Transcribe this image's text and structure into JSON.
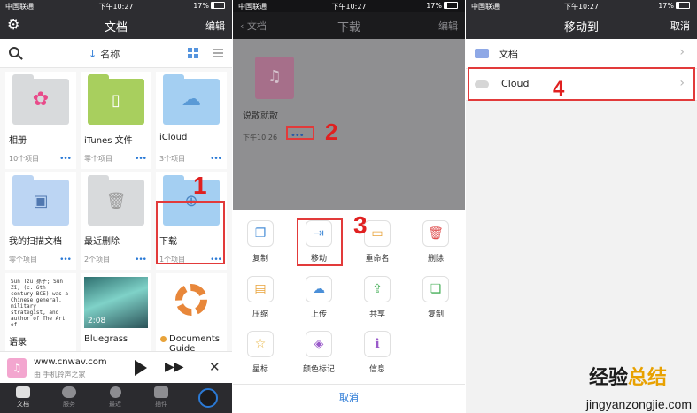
{
  "status": {
    "carrier": "中国联通",
    "time": "下午10:27",
    "battery": "17%"
  },
  "panel1": {
    "title": "文档",
    "edit": "编辑",
    "sort_label": "名称",
    "tiles": [
      {
        "name": "相册",
        "count": "10个项目"
      },
      {
        "name": "iTunes 文件",
        "count": "零个项目"
      },
      {
        "name": "iCloud",
        "count": "3个项目"
      },
      {
        "name": "我的扫描文档",
        "count": "零个项目"
      },
      {
        "name": "最近删除",
        "count": "2个项目"
      },
      {
        "name": "下载",
        "count": "1个项目"
      },
      {
        "name": "语录",
        "count": ""
      },
      {
        "name": "Bluegrass",
        "count": ""
      },
      {
        "name": "Documents Guide",
        "count": ""
      }
    ],
    "doc_preview": "Sun Tzu 孫子; Sūn Zǐ; (c. 6th century BCE) was a Chinese general, military strategist, and author of The Art of",
    "video_time": "2:08",
    "media": {
      "title": "www.cnwav.com",
      "subtitle": "由 手机铃声之家"
    },
    "tabs": [
      "文档",
      "服务",
      "最近",
      "插件"
    ]
  },
  "panel2": {
    "back": "文档",
    "title": "下载",
    "edit": "编辑",
    "file": {
      "name": "说散就散",
      "time": "下午10:26",
      "dots": "•••"
    },
    "actions": [
      "复制",
      "移动",
      "重命名",
      "删除",
      "压缩",
      "上传",
      "共享",
      "复制",
      "星标",
      "颜色标记",
      "信息"
    ],
    "cancel": "取消"
  },
  "panel3": {
    "title": "移动到",
    "cancel": "取消",
    "destinations": [
      {
        "name": "文档"
      },
      {
        "name": "iCloud"
      }
    ]
  },
  "annotations": [
    "1",
    "2",
    "3",
    "4"
  ],
  "watermark": {
    "line1a": "经验",
    "line1b": "总结",
    "line2": "jingyanzongjie.com"
  },
  "colors": {
    "accent": "#2b7ad6",
    "highlight": "#e23a3a",
    "navbar": "#2d2d31"
  }
}
